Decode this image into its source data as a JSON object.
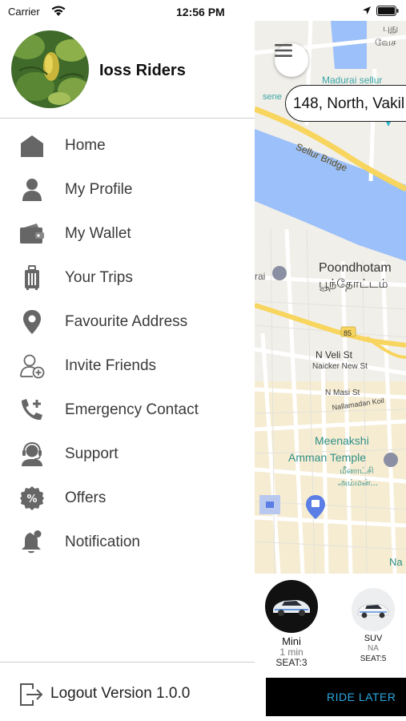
{
  "status_bar": {
    "carrier": "Carrier",
    "time": "12:56 PM"
  },
  "profile": {
    "name": "Ioss Riders"
  },
  "menu": [
    {
      "label": "Home",
      "icon": "home-icon"
    },
    {
      "label": "My Profile",
      "icon": "user-icon"
    },
    {
      "label": "My Wallet",
      "icon": "wallet-icon"
    },
    {
      "label": "Your Trips",
      "icon": "luggage-icon"
    },
    {
      "label": "Favourite Address",
      "icon": "location-pin-icon"
    },
    {
      "label": "Invite Friends",
      "icon": "add-user-icon"
    },
    {
      "label": "Emergency Contact",
      "icon": "phone-plus-icon"
    },
    {
      "label": "Support",
      "icon": "headset-icon"
    },
    {
      "label": "Offers",
      "icon": "percent-badge-icon"
    },
    {
      "label": "Notification",
      "icon": "bell-icon"
    }
  ],
  "footer": {
    "logout_label": "Logout Version 1.0.0"
  },
  "map": {
    "address": "148, North, Vakil",
    "labels": {
      "madurai": "Madurai sellur",
      "sene": "sene",
      "sellur_bridge": "Sellur Bridge",
      "poondhotam": "Poondhotam",
      "poondhotam_ta": "பூந்தோட்டம்",
      "n_veli_st": "N Veli St",
      "naicker_new_st": "Naicker New St",
      "n_masi_st": "N Masi St",
      "nallamadan": "Nallamadan Koil",
      "meenakshi": "Meenakshi",
      "amman_temple": "Amman Temple",
      "meenakshi_ta": "மீனாட்சி",
      "amman_ta": "அம்மன்...",
      "road_85": "85",
      "top_ta": "புது",
      "top_ta2": "வேச",
      "rai": "rai",
      "na": "Na"
    }
  },
  "vehicles": [
    {
      "name": "Mini",
      "eta": "1 min",
      "seat": "SEAT:3"
    },
    {
      "name": "SUV",
      "eta": "NA",
      "seat": "SEAT:5"
    }
  ],
  "ride_later": "RIDE LATER",
  "colors": {
    "accent": "#2aa8e0",
    "water": "#9cc0f9",
    "road_major": "#f7d55e"
  }
}
